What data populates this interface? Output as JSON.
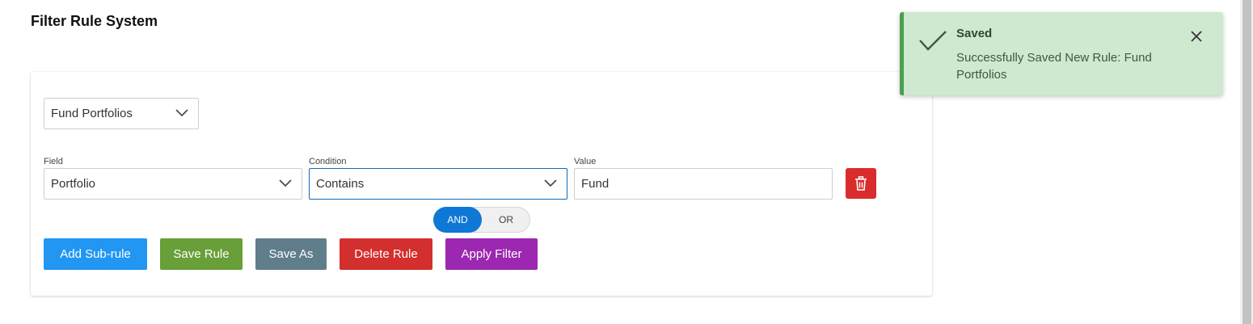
{
  "page": {
    "title": "Filter Rule System"
  },
  "rule_selector": {
    "value": "Fund Portfolios",
    "icon": "chevron-down-icon"
  },
  "rule_row": {
    "field": {
      "label": "Field",
      "value": "Portfolio"
    },
    "condition": {
      "label": "Condition",
      "value": "Contains"
    },
    "value": {
      "label": "Value",
      "value": "Fund"
    },
    "delete_icon": "trash-icon"
  },
  "logic_toggle": {
    "and_label": "AND",
    "or_label": "OR",
    "selected": "AND"
  },
  "actions": {
    "add_subrule": "Add Sub-rule",
    "save_rule": "Save Rule",
    "save_as": "Save As",
    "delete_rule": "Delete Rule",
    "apply_filter": "Apply Filter"
  },
  "toast": {
    "title": "Saved",
    "message": "Successfully Saved New Rule: Fund Portfolios",
    "icon": "check-icon",
    "close_icon": "close-icon"
  },
  "colors": {
    "primary": "#0f78d6",
    "add": "#2196f3",
    "save": "#689f38",
    "save_as": "#607d8b",
    "delete": "#d32f2f",
    "apply": "#9c27b0",
    "toast_bg": "#cfe8d0",
    "toast_accent": "#4aa04f"
  }
}
